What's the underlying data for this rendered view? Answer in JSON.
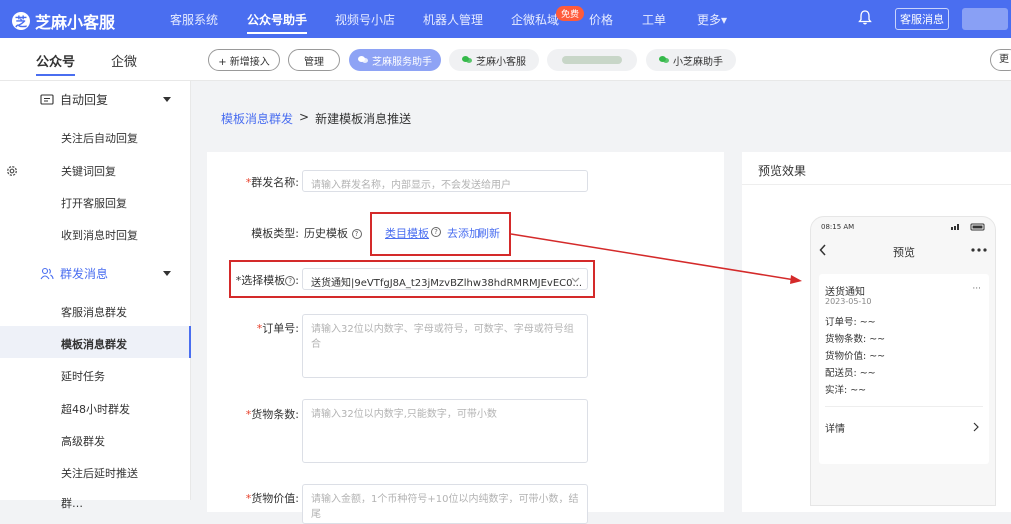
{
  "brand": {
    "name": "芝麻小客服"
  },
  "top_nav": [
    {
      "label": "客服系统"
    },
    {
      "label": "公众号助手"
    },
    {
      "label": "视频号小店"
    },
    {
      "label": "机器人管理"
    },
    {
      "label": "企微私域"
    },
    {
      "label": "价格"
    },
    {
      "label": "工单"
    },
    {
      "label": "更多▾"
    }
  ],
  "top_badge": "免费",
  "top_right": {
    "service_msg": "客服消息"
  },
  "sub_tabs": [
    {
      "label": "公众号"
    },
    {
      "label": "企微"
    }
  ],
  "account_pills": {
    "add": "+ 新增接入",
    "manage": "管理",
    "active": "芝麻服务助手",
    "p2": "芝麻小客服",
    "p4": "小芝麻助手",
    "more": "更"
  },
  "sidebar": {
    "auto_reply": "自动回复",
    "auto_items": [
      "关注后自动回复",
      "关键词回复",
      "打开客服回复",
      "收到消息时回复"
    ],
    "mass_msg": "群发消息",
    "mass_items": [
      "客服消息群发",
      "模板消息群发",
      "延时任务",
      "超48小时群发",
      "高级群发",
      "关注后延时推送",
      "群…"
    ]
  },
  "breadcrumb": {
    "parent": "模板消息群发",
    "sep": ">",
    "current": "新建模板消息推送"
  },
  "form": {
    "name_label": "群发名称:",
    "name_placeholder": "请输入群发名称，内部显示，不会发送给用户",
    "type_label": "模板类型:",
    "type_history": "历史模板",
    "type_category": "类目模板",
    "type_add": "去添加",
    "type_refresh": "刷新",
    "template_label": "*选择模板",
    "template_value": "送货通知|9eVTfgJ8A_t23jMzvBZlhw38hdRMRMJEvEC0...",
    "order_label": "订单号:",
    "order_placeholder": "请输入32位以内数字、字母或符号，可数字、字母或符号组合",
    "count_label": "货物条数:",
    "count_placeholder": "请输入32位以内数字,只能数字，可带小数",
    "price_label": "货物价值:",
    "price_placeholder": "请输入金额，1个币种符号+10位以内纯数字，可带小数，结尾"
  },
  "preview": {
    "title": "预览效果",
    "status_time": "08:15 AM",
    "nav_title": "预览",
    "msg_title": "送货通知",
    "msg_date": "2023-05-10",
    "fields": [
      "订单号:  ~~",
      "货物条数:  ~~",
      "货物价值:  ~~",
      "配送员:  ~~",
      "实洋:  ~~"
    ],
    "detail": "详情"
  },
  "colors": {
    "primary": "#4a6ef0",
    "highlight": "#d42a2a"
  }
}
